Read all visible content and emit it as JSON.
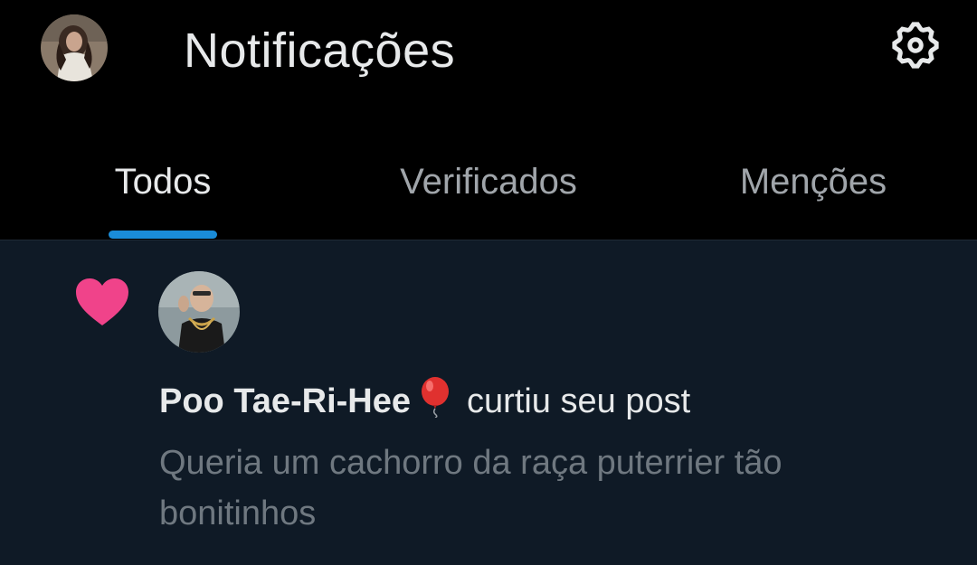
{
  "header": {
    "title": "Notificações",
    "avatar_icon": "user-avatar",
    "settings_icon": "gear-icon"
  },
  "tabs": [
    {
      "label": "Todos",
      "active": true
    },
    {
      "label": "Verificados",
      "active": false
    },
    {
      "label": "Menções",
      "active": false
    }
  ],
  "notification": {
    "type_icon": "heart-icon",
    "type_color": "#f91880",
    "actor_name": "Poo Tae-Ri-Hee",
    "actor_emoji": "balloon",
    "action_text": "curtiu seu post",
    "post_preview": "Queria um cachorro da raça puterrier tão bonitinhos"
  },
  "colors": {
    "background": "#000000",
    "notification_bg": "#0f1a26",
    "tab_indicator": "#1d9bf0",
    "primary_text": "#e7e9ea",
    "secondary_text": "#6f7880"
  }
}
